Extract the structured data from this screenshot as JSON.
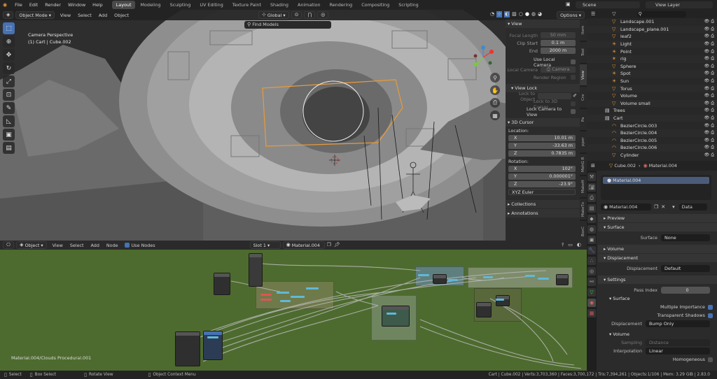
{
  "topbar": {
    "menus": [
      "File",
      "Edit",
      "Render",
      "Window",
      "Help"
    ],
    "workspaces": [
      "Layout",
      "Modeling",
      "Sculpting",
      "UV Editing",
      "Texture Paint",
      "Shading",
      "Animation",
      "Rendering",
      "Compositing",
      "Scripting"
    ],
    "active_workspace": "Layout",
    "scene": "Scene",
    "view_layer": "View Layer"
  },
  "viewport": {
    "mode": "Object Mode",
    "menus": [
      "View",
      "Select",
      "Add",
      "Object"
    ],
    "transform_orientation": "Global",
    "options_label": "Options",
    "info_line1": "Camera Perspective",
    "info_line2": "(1) Cart | Cube.002",
    "find_models": "Find Models"
  },
  "npanel": {
    "view_header": "View",
    "focal_length_label": "Focal Length",
    "focal_length": "50 mm",
    "clip_start_label": "Clip Start",
    "clip_start": "0.1 m",
    "end_label": "End",
    "end": "2000 m",
    "use_local_camera": "Use Local Camera",
    "local_camera_label": "Local Camera",
    "local_camera": "Camera",
    "render_region": "Render Region",
    "view_lock_header": "View Lock",
    "lock_to_object": "Lock to Object",
    "lock_to_3d_cursor": "Lock to 3D Cursor",
    "lock_camera_to_view": "Lock Camera to View",
    "cursor_header": "3D Cursor",
    "location_label": "Location:",
    "loc_x": "10.01 m",
    "loc_y": "-33.63 m",
    "loc_z": "0.7835 m",
    "rotation_label": "Rotation:",
    "rot_x": "102°",
    "rot_y": "0.000001°",
    "rot_z": "-23.9°",
    "rotation_mode": "XYZ Euler",
    "collections": "Collections",
    "annotations": "Annotations",
    "axis_x": "X",
    "axis_y": "Y",
    "axis_z": "Z",
    "tabs": [
      "Item",
      "Tool",
      "View",
      "Cre",
      "Pa",
      "pper",
      "MehG R",
      "MakeH",
      "MakeTx",
      "E",
      "BoxC",
      "Sketc",
      "Hard",
      "KIT",
      "Blend"
    ]
  },
  "outliner": {
    "search_placeholder": "",
    "rows": [
      {
        "name": "Landscape.001",
        "icon": "triangle-icon"
      },
      {
        "name": "Landscape_plane.001",
        "icon": "triangle-icon"
      },
      {
        "name": "leaf2",
        "icon": "triangle-icon"
      },
      {
        "name": "Light",
        "icon": "light-icon"
      },
      {
        "name": "Point",
        "icon": "light-icon"
      },
      {
        "name": "rig",
        "icon": "armature-icon"
      },
      {
        "name": "Sphere",
        "icon": "triangle-icon"
      },
      {
        "name": "Spot",
        "icon": "light-icon"
      },
      {
        "name": "Sun",
        "icon": "light-icon"
      },
      {
        "name": "Torus",
        "icon": "triangle-icon"
      },
      {
        "name": "Volume",
        "icon": "triangle-icon"
      },
      {
        "name": "Volume small",
        "icon": "triangle-icon"
      },
      {
        "name": "Trees",
        "icon": "collection-icon"
      },
      {
        "name": "Cart",
        "icon": "collection-icon"
      },
      {
        "name": "BezierCircle.003",
        "icon": "curve-icon"
      },
      {
        "name": "BezierCircle.004",
        "icon": "curve-icon"
      },
      {
        "name": "BezierCircle.005",
        "icon": "curve-icon"
      },
      {
        "name": "BezierCircle.006",
        "icon": "curve-icon"
      },
      {
        "name": "Cylinder",
        "icon": "triangle-icon"
      }
    ]
  },
  "properties": {
    "object": "Cube.002",
    "material": "Material.004",
    "slot_item": "Material.004",
    "material_field": "Material.004",
    "data_label": "Data",
    "preview": "Preview",
    "surface_header": "Surface",
    "surface_label": "Surface",
    "surface_value": "None",
    "volume_header": "Volume",
    "displacement_header": "Displacement",
    "displacement_label": "Displacement",
    "displacement_value": "Default",
    "settings_header": "Settings",
    "pass_index_label": "Pass Index",
    "pass_index": "0",
    "surface_sub": "Surface",
    "multiple_importance": "Multiple Importance",
    "transparent_shadows": "Transparent Shadows",
    "displacement2_label": "Displacement",
    "displacement2_value": "Bump Only",
    "volume_sub": "Volume",
    "sampling_label": "Sampling",
    "sampling_value": "Distance",
    "interpolation_label": "Interpolation",
    "interpolation_value": "Linear",
    "homogeneous": "Homogeneous"
  },
  "node_editor": {
    "type": "Object",
    "menus": [
      "View",
      "Select",
      "Add",
      "Node"
    ],
    "use_nodes": "Use Nodes",
    "slot": "Slot 1",
    "material": "Material.004",
    "path": "Material.004/Clouds Procedural.001"
  },
  "statusbar": {
    "select": "Select",
    "box_select": "Box Select",
    "rotate_view": "Rotate View",
    "context_menu": "Object Context Menu",
    "stats": "Cart | Cube.002 | Verts:3,703,360 | Faces:3,700,172 | Tris:7,394,261 | Objects:1/106 | Mem: 3.29 GiB | 2.83.0"
  },
  "colors": {
    "accent": "#4772b3",
    "node_bg": "#4d6b2e",
    "selection_orange": "#e79b3b"
  }
}
